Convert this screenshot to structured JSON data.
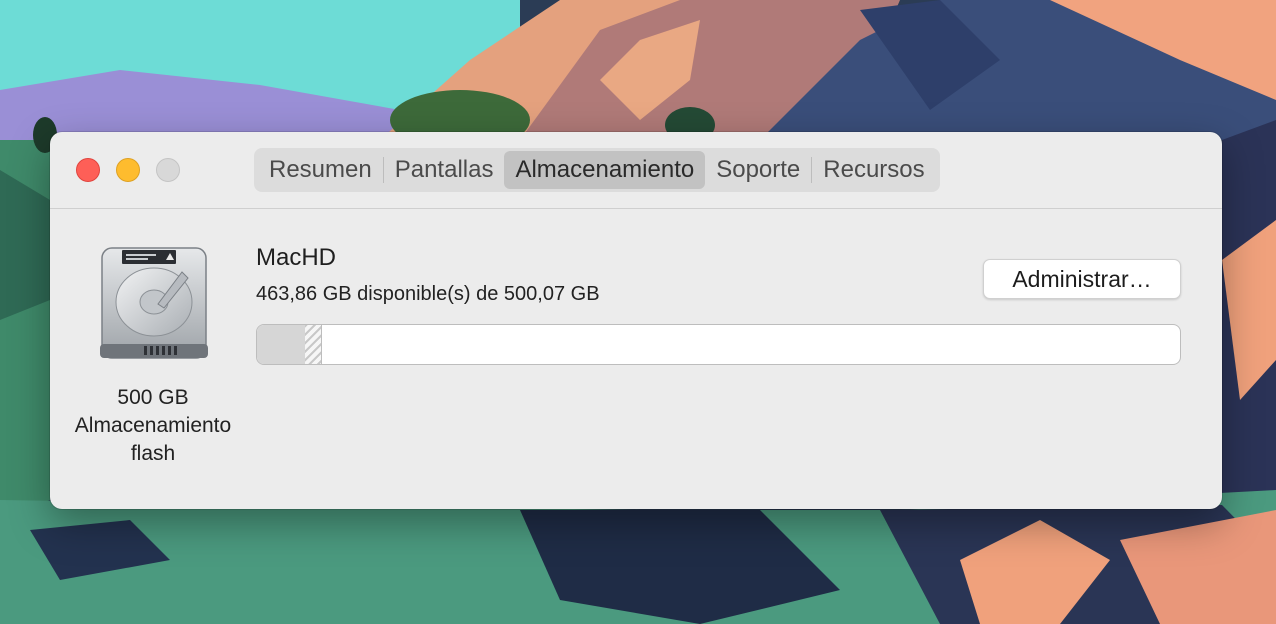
{
  "window": {
    "tabs": [
      {
        "label": "Resumen",
        "active": false
      },
      {
        "label": "Pantallas",
        "active": false
      },
      {
        "label": "Almacenamiento",
        "active": true
      },
      {
        "label": "Soporte",
        "active": false
      },
      {
        "label": "Recursos",
        "active": false
      }
    ]
  },
  "disk": {
    "icon": "hard-drive-icon",
    "capacity_line": "500 GB",
    "type_line1": "Almacenamiento",
    "type_line2": "flash"
  },
  "volume": {
    "name": "MacHD",
    "availability": "463,86 GB disponible(s) de 500,07 GB",
    "manage_label": "Administrar…",
    "used_fraction": 0.052,
    "other_fraction": 0.018
  },
  "colors": {
    "close": "#fe5f57",
    "minimize": "#febc2e",
    "zoom": "#d8d8d8"
  }
}
